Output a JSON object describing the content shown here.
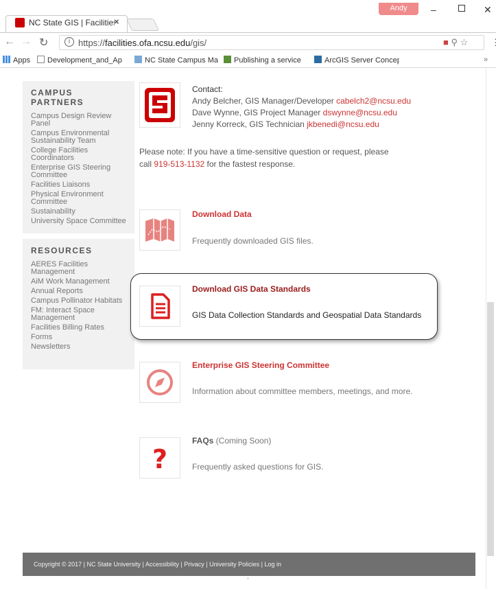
{
  "browser": {
    "tab_title": "NC State GIS | Facilities D",
    "tab_close": "×",
    "profile_name": "Andy",
    "url_prefix": "https://",
    "url_host": "facilities.ofa.ncsu.edu",
    "url_path": "/gis/",
    "bookmarks": [
      "Apps",
      "Development_and_Ap",
      "NC State Campus Ma",
      "Publishing a service",
      "ArcGIS Server Concep"
    ],
    "bookmarks_overflow": "»"
  },
  "sidebar": {
    "partners_heading": "CAMPUS PARTNERS",
    "partners": [
      "Campus Design Review Panel",
      "Campus Environmental Sustainability Team",
      "College Facilities Coordinators",
      "Enterprise GIS Steering Committee",
      "Facilities Liaisons",
      "Physical Environment Committee",
      "Sustainability",
      "University Space Committee"
    ],
    "resources_heading": "RESOURCES",
    "resources": [
      "AERES Facilities Management",
      "AiM Work Management",
      "Annual Reports",
      "Campus Pollinator Habitats",
      "FM: Interact Space Management",
      "Facilities Billing Rates",
      "Forms",
      "Newsletters"
    ]
  },
  "contact": {
    "label": "Contact:",
    "people": [
      {
        "desc": "Andy Belcher, GIS Manager/Developer ",
        "email": "cabelch2@ncsu.edu"
      },
      {
        "desc": "Dave Wynne, GIS Project Manager ",
        "email": "dswynne@ncsu.edu"
      },
      {
        "desc": "Jenny Korreck, GIS Technician ",
        "email": "jkbenedi@ncsu.edu"
      }
    ],
    "note_line1": "Please note: If you have a time-sensitive question or request, please",
    "note_call": "call ",
    "note_phone": "919-513-1132",
    "note_rest": " for the fastest response."
  },
  "cards": [
    {
      "title": "Download Data",
      "desc": "Frequently downloaded GIS files.",
      "icon": "map-icon"
    },
    {
      "title": "Download GIS Data Standards",
      "desc": "GIS Data Collection Standards and Geospatial Data Standards",
      "icon": "document-icon"
    },
    {
      "title": "Enterprise GIS Steering Committee",
      "desc": "Information about committee members, meetings, and more.",
      "icon": "compass-icon"
    },
    {
      "title": "FAQs",
      "title_suffix": " (Coming Soon)",
      "desc": "Frequently asked questions for GIS.",
      "icon": "question-icon"
    }
  ],
  "footer": {
    "copyright": "Copyright © 2017 | NC State University | ",
    "links": [
      "Accessibility",
      "Privacy",
      "University Policies",
      "Log in"
    ]
  },
  "colors": {
    "accent": "#cc3333",
    "brand": "#cc0000",
    "sidebar_bg": "#f1f1f1",
    "footer_bg": "#707070"
  }
}
